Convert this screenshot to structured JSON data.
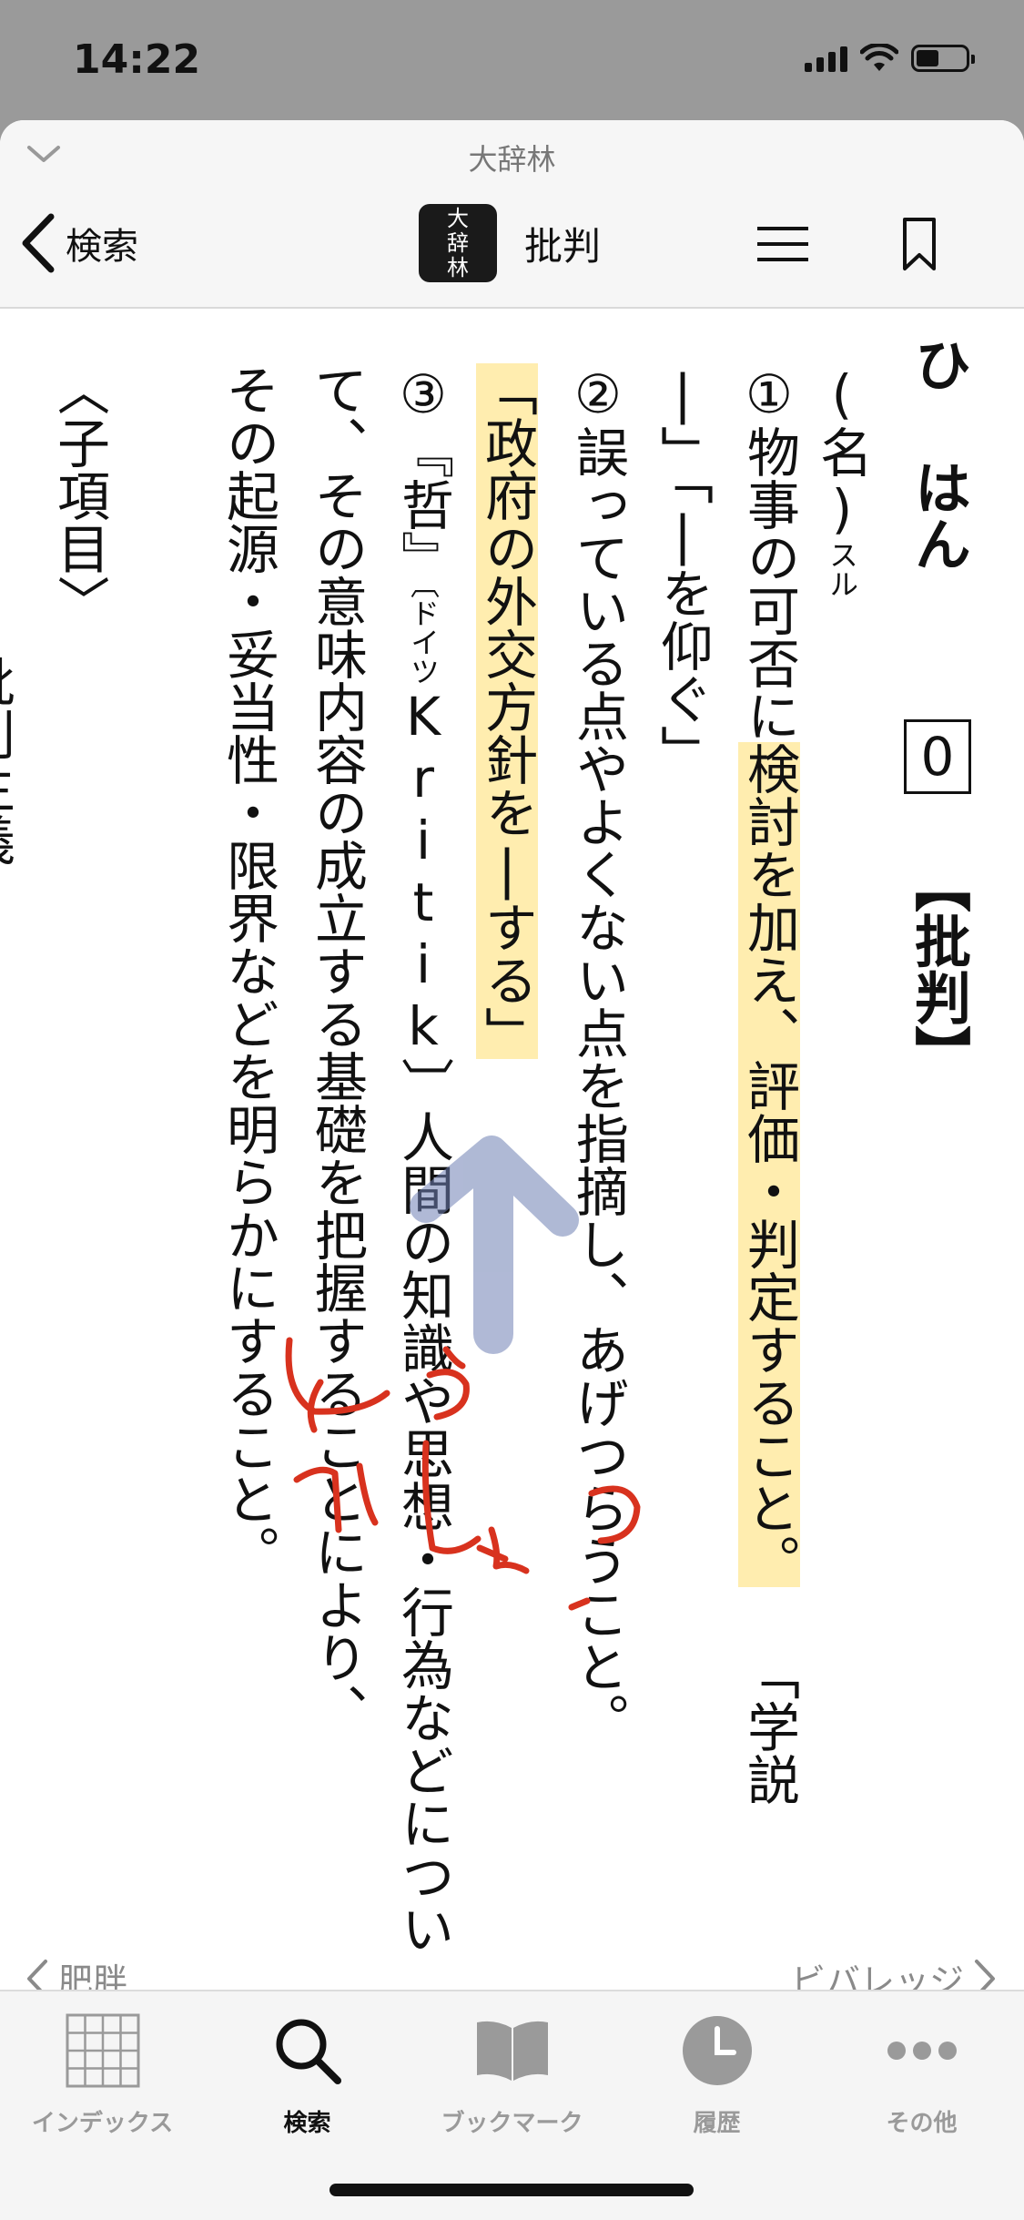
{
  "status": {
    "time": "14:22"
  },
  "header": {
    "dictionary_name": "大辞林",
    "back_label": "検索",
    "headword_title": "批判",
    "logo_chars": [
      "大",
      "辞",
      "林"
    ]
  },
  "entry": {
    "reading": "ひ はん",
    "accent": "0",
    "kanji": "【批判】",
    "pos": "(名)",
    "pos_suffix": "スル",
    "sense1_a": "①物事の可否に",
    "sense1_highlight": "検討を加え、評価・判定すること。",
    "sense1_example1_a": "「学説",
    "sense1_example1_b": "|」「|を仰ぐ」",
    "sense2": "②誤っている点やよくない点を指摘し、あげつらうこと。",
    "sense2_example": "「政府の外交方針を|する」",
    "sense3_a": "③『哲』",
    "sense3_lang": "〔ドイツ",
    "sense3_word": "Kritik〕",
    "sense3_b": "人間の知識や思想・行為などについ",
    "sense3_c": "て、その意味内容の成立する基礎を把握することにより、",
    "sense3_d": "その起源・妥当性・限界などを明らかにすること。",
    "subitems": "〈子項目〉",
    "subitem_link": "批判主義"
  },
  "pager": {
    "prev": "肥胖",
    "next": "ビバレッジ"
  },
  "tabs": [
    {
      "label": "インデックス",
      "icon": "grid-icon",
      "active": false
    },
    {
      "label": "検索",
      "icon": "search-icon",
      "active": true
    },
    {
      "label": "ブックマーク",
      "icon": "book-icon",
      "active": false
    },
    {
      "label": "履歴",
      "icon": "clock-icon",
      "active": false
    },
    {
      "label": "その他",
      "icon": "more-icon",
      "active": false
    }
  ],
  "colors": {
    "highlight": "#ffde6e",
    "link": "#1028c8",
    "ink_red": "#d8321e",
    "arrow_blue": "#6f80b4"
  }
}
